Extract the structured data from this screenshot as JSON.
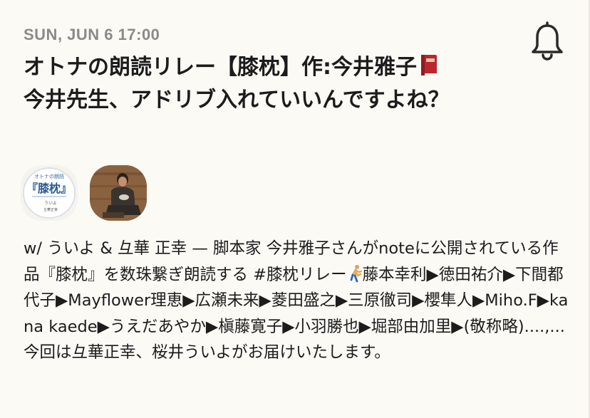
{
  "event": {
    "date_time": "SUN, JUN 6 17:00",
    "title": "オトナの朗読リレー【膝枕】作:今井雅子",
    "subtitle": "今井先生、アドリブ入れていいんですよね？",
    "description": "w/ ういよ & 彑華 正幸 — 脚本家 今井雅子さんがnoteに公開されている作品『膝枕』を数珠繋ぎ朗読する #膝枕リレー",
    "relay_list": "藤本幸利▶徳田祐介▶下間都代子▶Mayflower理恵▶広瀬未来▶菱田盛之▶三原徹司▶櫻隼人▶Miho.F▶kana kaede▶うえだあやか▶槇藤寛子▶小羽勝也▶堀部由加里▶(敬称略)....,...今回は彑華正幸、桜井ういよがお届けいたします。",
    "title_icon": "red-book-icon",
    "description_icon": "runner-icon",
    "notify_icon": "bell-icon"
  },
  "hosts": [
    {
      "name": "ういよ",
      "avatar_icon": "hiza-makura-logo"
    },
    {
      "name": "彑華 正幸",
      "avatar_icon": "person-photo"
    }
  ],
  "colors": {
    "background": "#fbfaf5",
    "date_text": "#8a8a8a",
    "title_text": "#1c1c1c",
    "book_red": "#b8262e"
  }
}
